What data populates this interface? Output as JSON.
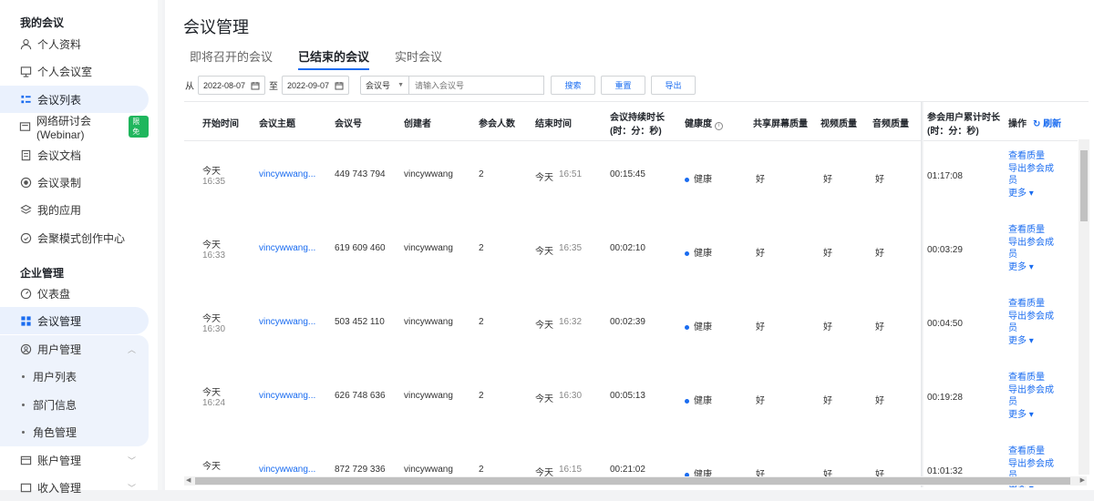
{
  "sidebar": {
    "section1": "我的会议",
    "section2": "企业管理",
    "items": [
      {
        "label": "个人资料",
        "icon": "user-icon"
      },
      {
        "label": "个人会议室",
        "icon": "meeting-room-icon"
      },
      {
        "label": "会议列表",
        "icon": "list-icon"
      },
      {
        "label": "网络研讨会(Webinar)",
        "icon": "webinar-icon",
        "badge": "限免"
      },
      {
        "label": "会议文档",
        "icon": "document-icon"
      },
      {
        "label": "会议录制",
        "icon": "record-icon"
      },
      {
        "label": "我的应用",
        "icon": "apps-icon"
      },
      {
        "label": "会聚模式创作中心",
        "icon": "creator-icon"
      },
      {
        "label": "仪表盘",
        "icon": "dashboard-icon"
      },
      {
        "label": "会议管理",
        "icon": "grid-icon"
      },
      {
        "label": "用户管理",
        "icon": "user-manage-icon"
      },
      {
        "label": "账户管理",
        "icon": "account-icon"
      },
      {
        "label": "收入管理",
        "icon": "income-icon"
      }
    ],
    "sub_items": [
      "用户列表",
      "部门信息",
      "角色管理"
    ]
  },
  "main": {
    "title": "会议管理",
    "tabs": [
      "即将召开的会议",
      "已结束的会议",
      "实时会议"
    ],
    "filter": {
      "from_label": "从",
      "to_label": "至",
      "start_date": "2022-08-07",
      "end_date": "2022-09-07",
      "select_value": "会议号",
      "search_placeholder": "请输入会议号",
      "search_btn": "搜索",
      "reset_btn": "重置",
      "export_btn": "导出"
    },
    "headers": {
      "start": "开始时间",
      "topic": "会议主题",
      "number": "会议号",
      "creator": "创建者",
      "participants": "参会人数",
      "end": "结束时间",
      "duration1": "会议持续时长",
      "duration2": "(时：分：秒)",
      "health": "健康度",
      "share": "共享屏幕质量",
      "video": "视频质量",
      "audio": "音频质量",
      "cum1": "参会用户累计时长",
      "cum2": "(时：分：秒)",
      "ops": "操作",
      "refresh": "刷新"
    },
    "ops_labels": {
      "quality": "查看质量",
      "export1": "导出参会成",
      "export2": "员",
      "more": "更多"
    },
    "rows": [
      {
        "day": "今天",
        "start": "16:35",
        "topic": "vincywwang...",
        "number": "449 743 794",
        "creator": "vincywwang",
        "participants": "2",
        "end_day": "今天",
        "end": "16:51",
        "duration": "00:15:45",
        "health": "健康",
        "share": "好",
        "video": "好",
        "audio": "好",
        "cum": "01:17:08"
      },
      {
        "day": "今天",
        "start": "16:33",
        "topic": "vincywwang...",
        "number": "619 609 460",
        "creator": "vincywwang",
        "participants": "2",
        "end_day": "今天",
        "end": "16:35",
        "duration": "00:02:10",
        "health": "健康",
        "share": "好",
        "video": "好",
        "audio": "好",
        "cum": "00:03:29"
      },
      {
        "day": "今天",
        "start": "16:30",
        "topic": "vincywwang...",
        "number": "503 452 110",
        "creator": "vincywwang",
        "participants": "2",
        "end_day": "今天",
        "end": "16:32",
        "duration": "00:02:39",
        "health": "健康",
        "share": "好",
        "video": "好",
        "audio": "好",
        "cum": "00:04:50"
      },
      {
        "day": "今天",
        "start": "16:24",
        "topic": "vincywwang...",
        "number": "626 748 636",
        "creator": "vincywwang",
        "participants": "2",
        "end_day": "今天",
        "end": "16:30",
        "duration": "00:05:13",
        "health": "健康",
        "share": "好",
        "video": "好",
        "audio": "好",
        "cum": "00:19:28"
      },
      {
        "day": "今天",
        "start": "",
        "topic": "vincywwang...",
        "number": "872 729 336",
        "creator": "vincywwang",
        "participants": "2",
        "end_day": "今天",
        "end": "16:15",
        "duration": "00:21:02",
        "health": "健康",
        "share": "好",
        "video": "好",
        "audio": "好",
        "cum": "01:01:32"
      }
    ]
  }
}
